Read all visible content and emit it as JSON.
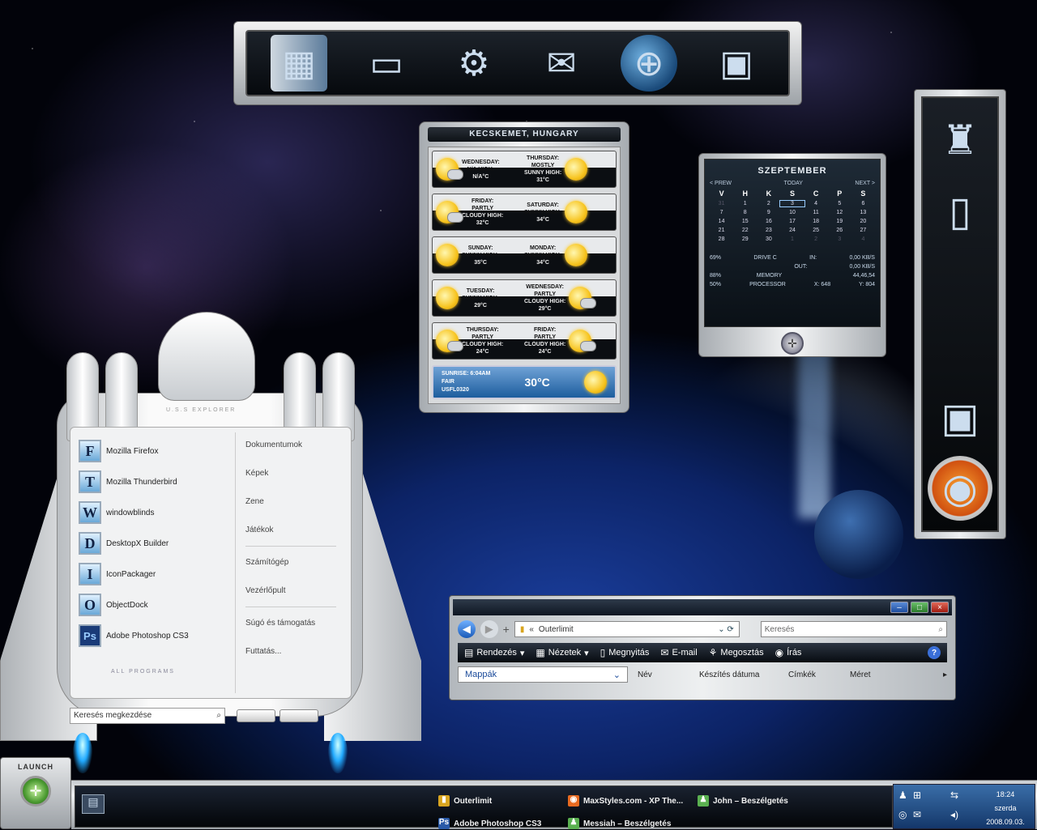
{
  "top_dock": {
    "icons": [
      "server-icon",
      "ram-icon",
      "lamp-gear-icon",
      "mailbox-icon",
      "globe-icon",
      "chip-icon"
    ]
  },
  "right_dock": {
    "icons": [
      "lamp-icon",
      "trash-icon",
      "chip-icon",
      "firefox-icon"
    ]
  },
  "weather": {
    "title": "KECSKEMET, HUNGARY",
    "rows": [
      [
        {
          "lines": [
            "WEDNESDAY:",
            "N/A HIGH:",
            "N/A°C"
          ],
          "icon": "partly-cloudy"
        },
        {
          "lines": [
            "THURSDAY:",
            "MOSTLY",
            "SUNNY HIGH:",
            "31°C"
          ],
          "icon": "sunny"
        }
      ],
      [
        {
          "lines": [
            "FRIDAY:",
            "PARTLY",
            "CLOUDY HIGH:",
            "32°C"
          ],
          "icon": "partly-cloudy"
        },
        {
          "lines": [
            "SATURDAY:",
            "SUNNY HIGH:",
            "34°C"
          ],
          "icon": "sunny"
        }
      ],
      [
        {
          "lines": [
            "SUNDAY:",
            "SUNNY HIGH:",
            "35°C"
          ],
          "icon": "sunny"
        },
        {
          "lines": [
            "MONDAY:",
            "SUNNY HIGH:",
            "34°C"
          ],
          "icon": "sunny"
        }
      ],
      [
        {
          "lines": [
            "TUESDAY:",
            "SUNNY HIGH:",
            "29°C"
          ],
          "icon": "sunny"
        },
        {
          "lines": [
            "WEDNESDAY:",
            "PARTLY",
            "CLOUDY HIGH:",
            "29°C"
          ],
          "icon": "partly-cloudy"
        }
      ],
      [
        {
          "lines": [
            "THURSDAY:",
            "PARTLY",
            "CLOUDY HIGH:",
            "24°C"
          ],
          "icon": "partly-cloudy"
        },
        {
          "lines": [
            "FRIDAY:",
            "PARTLY",
            "CLOUDY HIGH:",
            "24°C"
          ],
          "icon": "partly-cloudy"
        }
      ]
    ],
    "current": {
      "sunrise": "SUNRISE: 6:04AM",
      "condition": "FAIR",
      "station": "USFL0320",
      "temp": "30°C"
    }
  },
  "calendar": {
    "month": "SZEPTEMBER",
    "prev": "< PREW",
    "today": "TODAY",
    "next": "NEXT >",
    "weekdays": [
      "V",
      "H",
      "K",
      "S",
      "C",
      "P",
      "S"
    ],
    "days": [
      "31",
      "1",
      "2",
      "3",
      "4",
      "5",
      "6",
      "7",
      "8",
      "9",
      "10",
      "11",
      "12",
      "13",
      "14",
      "15",
      "16",
      "17",
      "18",
      "19",
      "20",
      "21",
      "22",
      "23",
      "24",
      "25",
      "26",
      "27",
      "28",
      "29",
      "30",
      "1",
      "2",
      "3",
      "4"
    ],
    "stats": [
      [
        "69%",
        "DRIVE C",
        "IN:",
        "0,00 KB/S"
      ],
      [
        "",
        "",
        "OUT:",
        "0,00 KB/S"
      ],
      [
        "88%",
        "MEMORY",
        "",
        "44,46,54"
      ],
      [
        "50%",
        "PROCESSOR",
        "X: 648",
        "Y: 804"
      ]
    ]
  },
  "ship": {
    "name": "U.S.S EXPLORER"
  },
  "start_menu": {
    "programs": [
      {
        "icon": "F",
        "label": "Mozilla Firefox"
      },
      {
        "icon": "T",
        "label": "Mozilla Thunderbird"
      },
      {
        "icon": "W",
        "label": "windowblinds"
      },
      {
        "icon": "D",
        "label": "DesktopX Builder"
      },
      {
        "icon": "I",
        "label": "IconPackager"
      },
      {
        "icon": "O",
        "label": "ObjectDock"
      },
      {
        "icon": "Ps",
        "label": "Adobe Photoshop CS3"
      }
    ],
    "all_programs": "ALL PROGRAMS",
    "places": [
      "Dokumentumok",
      "Képek",
      "Zene",
      "Játékok",
      "Számítógép",
      "Vezérlőpult",
      "Súgó és támogatás",
      "Futtatás..."
    ],
    "search_placeholder": "Keresés megkezdése"
  },
  "explorer": {
    "address": "Outerlimit",
    "address_prefix": "«",
    "search": "Keresés",
    "toolbar": {
      "organize": "Rendezés",
      "views": "Nézetek",
      "open": "Megnyitás",
      "email": "E-mail",
      "share": "Megosztás",
      "burn": "Írás"
    },
    "folders": "Mappák",
    "columns": [
      "Név",
      "Készítés dátuma",
      "Címkék",
      "Méret"
    ]
  },
  "launch": {
    "label": "LAUNCH"
  },
  "taskbar": {
    "tasks": [
      {
        "label": "Outerlimit",
        "icon": "folder-icon"
      },
      {
        "label": "MaxStyles.com - XP The...",
        "icon": "firefox-icon"
      },
      {
        "label": "John – Beszélgetés",
        "icon": "messenger-icon"
      },
      {
        "label": "Adobe Photoshop CS3",
        "icon": "photoshop-icon"
      },
      {
        "label": "Messiah – Beszélgetés",
        "icon": "messenger-icon"
      }
    ],
    "clock": {
      "time": "18:24",
      "day": "szerda",
      "date": "2008.09.03."
    }
  }
}
